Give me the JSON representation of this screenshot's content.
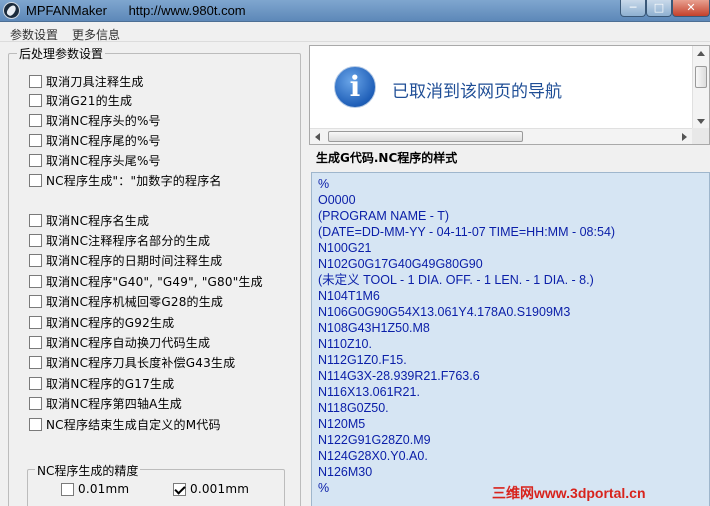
{
  "window": {
    "title": "MPFANMaker",
    "url": "http://www.980t.com",
    "min_glyph": "─",
    "max_glyph": "□",
    "close_glyph": "✕",
    "icon": "app-logo-icon"
  },
  "menu": [
    "参数设置",
    "更多信息"
  ],
  "left_group": {
    "legend": "后处理参数设置",
    "options_a": [
      {
        "label": "取消刀具注释生成",
        "checked": false
      },
      {
        "label": "取消G21的生成",
        "checked": false
      },
      {
        "label": "取消NC程序头的%号",
        "checked": false
      },
      {
        "label": "取消NC程序尾的%号",
        "checked": false
      },
      {
        "label": "取消NC程序头尾%号",
        "checked": false
      },
      {
        "label": "NC程序生成\"：\"加数字的程序名",
        "checked": false
      }
    ],
    "options_b": [
      {
        "label": "取消NC程序名生成",
        "checked": false
      },
      {
        "label": "取消NC注释程序名部分的生成",
        "checked": false
      },
      {
        "label": "取消NC程序的日期时间注释生成",
        "checked": false
      },
      {
        "label": "取消NC程序\"G40\", \"G49\", \"G80\"生成",
        "checked": false
      },
      {
        "label": "取消NC程序机械回零G28的生成",
        "checked": false
      },
      {
        "label": "取消NC程序的G92生成",
        "checked": false
      },
      {
        "label": "取消NC程序自动换刀代码生成",
        "checked": false
      },
      {
        "label": "取消NC程序刀具长度补偿G43生成",
        "checked": false
      },
      {
        "label": "取消NC程序的G17生成",
        "checked": false
      },
      {
        "label": "取消NC程序第四轴A生成",
        "checked": false
      },
      {
        "label": "NC程序结束生成自定义的M代码",
        "checked": false
      }
    ]
  },
  "precision": {
    "legend": "NC程序生成的精度",
    "options": [
      {
        "label": "0.01mm",
        "checked": false
      },
      {
        "label": "0.001mm",
        "checked": true
      }
    ]
  },
  "browser": {
    "message": "已取消到该网页的导航",
    "icon": "info-icon"
  },
  "sample": {
    "title": "生成G代码.NC程序的样式",
    "lines": [
      "%",
      "O0000",
      "(PROGRAM NAME - T)",
      "(DATE=DD-MM-YY - 04-11-07 TIME=HH:MM - 08:54)",
      "N100G21",
      "N102G0G17G40G49G80G90",
      "(未定义 TOOL - 1 DIA. OFF. - 1 LEN. - 1 DIA. - 8.)",
      "N104T1M6",
      "N106G0G90G54X13.061Y4.178A0.S1909M3",
      "N108G43H1Z50.M8",
      "N110Z10.",
      "N112G1Z0.F15.",
      "N114G3X-28.939R21.F763.6",
      "N116X13.061R21.",
      "N118G0Z50.",
      "N120M5",
      "N122G91G28Z0.M9",
      "N124G28X0.Y0.A0.",
      "N126M30",
      "%"
    ]
  },
  "watermark": "三维网www.3dportal.cn",
  "colors": {
    "code_text": "#0a1ea8",
    "sample_bg": "#d6e5f3",
    "nav_message": "#1f4e96",
    "watermark": "#d8231c"
  }
}
